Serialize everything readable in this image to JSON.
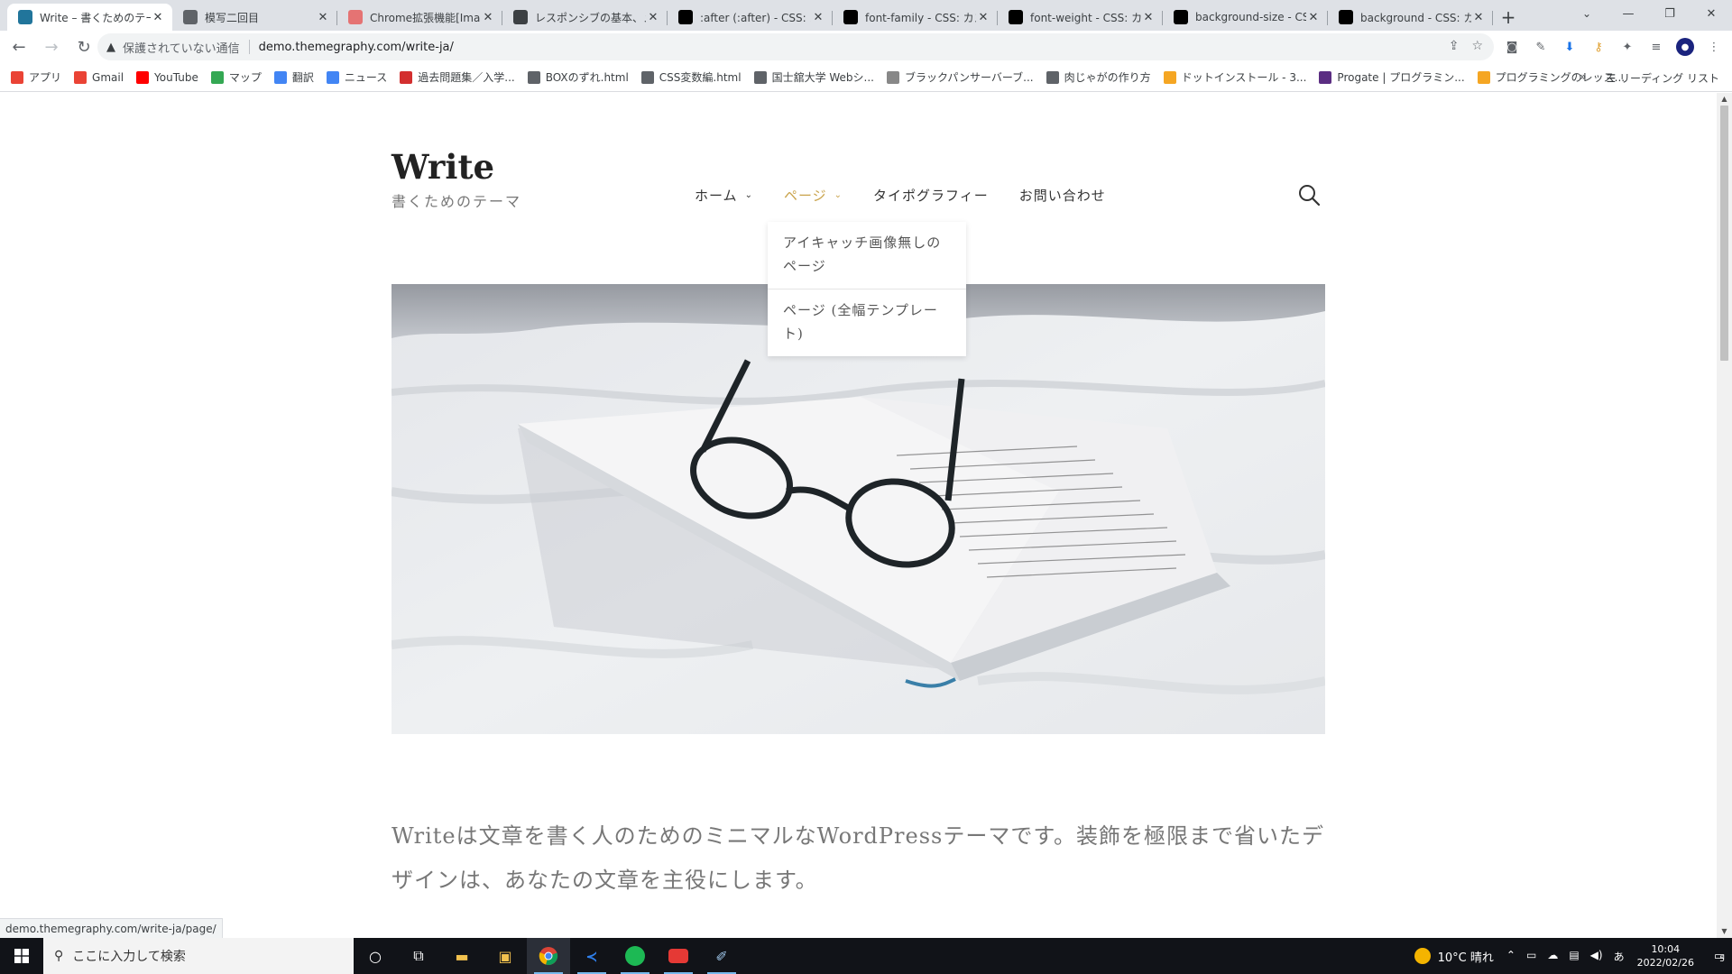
{
  "browser": {
    "tabs": [
      {
        "title": "Write – 書くためのテーマ",
        "favicon": "wordpress-icon",
        "color": "#21759b",
        "active": true
      },
      {
        "title": "模写二回目",
        "favicon": "globe-icon",
        "color": "#5f6368",
        "active": false
      },
      {
        "title": "Chrome拡張機能[Imag",
        "favicon": "extension-icon",
        "color": "#e57373",
        "active": false
      },
      {
        "title": "レスポンシブの基本、メデ",
        "favicon": "site-icon",
        "color": "#3c4043",
        "active": false
      },
      {
        "title": ":after (:after) - CSS: カ",
        "favicon": "mdn-icon",
        "color": "#000000",
        "active": false
      },
      {
        "title": "font-family - CSS: カス",
        "favicon": "mdn-icon",
        "color": "#000000",
        "active": false
      },
      {
        "title": "font-weight - CSS: カ",
        "favicon": "mdn-icon",
        "color": "#000000",
        "active": false
      },
      {
        "title": "background-size - CS",
        "favicon": "mdn-icon",
        "color": "#000000",
        "active": false
      },
      {
        "title": "background - CSS: カ",
        "favicon": "mdn-icon",
        "color": "#000000",
        "active": false
      }
    ],
    "address": {
      "security_text": "保護されていない通信",
      "url": "demo.themegraphy.com/write-ja/"
    },
    "bookmarks": [
      {
        "label": "アプリ",
        "icon": "apps-grid-icon",
        "color": "#ea4335"
      },
      {
        "label": "Gmail",
        "icon": "gmail-icon",
        "color": "#ea4335"
      },
      {
        "label": "YouTube",
        "icon": "youtube-icon",
        "color": "#ff0000"
      },
      {
        "label": "マップ",
        "icon": "maps-icon",
        "color": "#34a853"
      },
      {
        "label": "翻訳",
        "icon": "translate-icon",
        "color": "#4285f4"
      },
      {
        "label": "ニュース",
        "icon": "news-icon",
        "color": "#4285f4"
      },
      {
        "label": "過去問題集／入学...",
        "icon": "kawai-icon",
        "color": "#d32f2f"
      },
      {
        "label": "BOXのずれ.html",
        "icon": "globe-icon",
        "color": "#5f6368"
      },
      {
        "label": "CSS変数編.html",
        "icon": "globe-icon",
        "color": "#5f6368"
      },
      {
        "label": "国士舘大学 Webシ...",
        "icon": "globe-icon",
        "color": "#5f6368"
      },
      {
        "label": "ブラックパンサーバーブ...",
        "icon": "w-icon",
        "color": "#888888"
      },
      {
        "label": "肉じゃがの作り方",
        "icon": "globe-icon",
        "color": "#5f6368"
      },
      {
        "label": "ドットインストール - 3...",
        "icon": "dotinstall-icon",
        "color": "#f5a623"
      },
      {
        "label": "Progate | プログラミン...",
        "icon": "progate-icon",
        "color": "#5b2d82"
      },
      {
        "label": "プログラミングのレッス...",
        "icon": "dotinstall-icon",
        "color": "#f5a623"
      }
    ],
    "bookmarks_overflow": "»",
    "reading_list": "リーディング リスト",
    "status_url": "demo.themegraphy.com/write-ja/page/"
  },
  "site": {
    "title": "Write",
    "description": "書くためのテーマ",
    "menu": [
      {
        "label": "ホーム",
        "has_children": true,
        "current": false
      },
      {
        "label": "ページ",
        "has_children": true,
        "current": true
      },
      {
        "label": "タイポグラフィー",
        "has_children": false,
        "current": false
      },
      {
        "label": "お問い合わせ",
        "has_children": false,
        "current": false
      }
    ],
    "dropdown": [
      "アイキャッチ画像無しのページ",
      "ページ (全幅テンプレート)"
    ],
    "intro": "Writeは文章を書く人のためのミニマルなWordPressテーマです。装飾を極限まで省いたデザインは、あなたの文章を主役にします。",
    "accent_color": "#c9a34b"
  },
  "taskbar": {
    "search_placeholder": "ここに入力して検索",
    "weather": "10°C 晴れ",
    "time": "10:04",
    "date": "2022/02/26",
    "notifications": "5",
    "ime": "あ"
  }
}
